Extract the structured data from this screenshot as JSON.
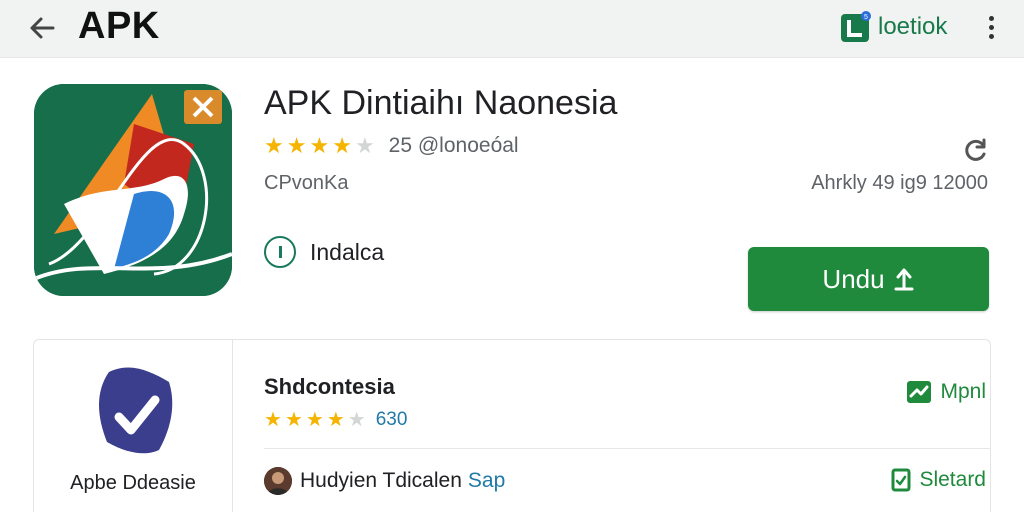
{
  "topbar": {
    "title": "APK",
    "brand": {
      "name": "loetiok",
      "logo_icon": "brand-logo-icon"
    },
    "back_icon": "arrow-left-icon",
    "more_icon": "more-vertical-icon"
  },
  "app": {
    "name": "APK Dintiaihı Naonesia",
    "rating_stars": 4,
    "rating_text": "25 @lonoeóal",
    "developer": "CPvonKa",
    "meta": "Ahrkly 49 ig9 12000",
    "info_label": "Indalca",
    "download_label": "Undu",
    "colors": {
      "accent": "#1f8a3c",
      "icon_bg": "#166e4b",
      "star": "#f4b400"
    }
  },
  "related": {
    "app_label": "Apbe Ddeasie",
    "title": "Shdcontesia",
    "rating_stars": 4,
    "rating_count": "630",
    "top_action": "Mpnl",
    "author_name": "Hudyien Tdicalen",
    "author_tag": "Sap",
    "bottom_action": "Sletard"
  }
}
